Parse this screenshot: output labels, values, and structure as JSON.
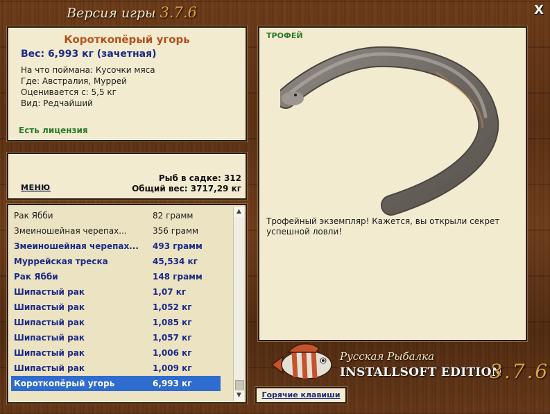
{
  "window": {
    "version_label": "Версия игры",
    "version": "3.7.6",
    "close_glyph": "X"
  },
  "fish_info": {
    "name": "Короткопёрый угорь",
    "weight": "Вес: 6,993 кг (зачетная)",
    "caught_on": "На что поймана: Кусочки мяса",
    "location": "Где: Австралия, Муррей",
    "rated_from": "Оценивается с: 5,5 кг",
    "rarity": "Вид: Редчайший",
    "license": "Есть лицензия"
  },
  "stats": {
    "menu_label": "МЕНЮ",
    "fish_in_keepnet": "Рыб в садке: 312",
    "total_weight": "Общий вес: 3717,29 кг"
  },
  "catch_list": {
    "rows": [
      {
        "name": "Рак Ябби",
        "weight": "82 грамм",
        "style": "normal"
      },
      {
        "name": "Змеиношейная черепах...",
        "weight": "356 грамм",
        "style": "normal"
      },
      {
        "name": "Змеиношейная черепах...",
        "weight": "493 грамм",
        "style": "bold"
      },
      {
        "name": "Муррейская треска",
        "weight": "45,534 кг",
        "style": "bold"
      },
      {
        "name": "Рак Ябби",
        "weight": "148 грамм",
        "style": "bold"
      },
      {
        "name": "Шипастый рак",
        "weight": "1,07 кг",
        "style": "bold"
      },
      {
        "name": "Шипастый рак",
        "weight": "1,052 кг",
        "style": "bold"
      },
      {
        "name": "Шипастый рак",
        "weight": "1,085 кг",
        "style": "bold"
      },
      {
        "name": "Шипастый рак",
        "weight": "1,057 кг",
        "style": "bold"
      },
      {
        "name": "Шипастый рак",
        "weight": "1,006 кг",
        "style": "bold"
      },
      {
        "name": "Шипастый рак",
        "weight": "1,009 кг",
        "style": "bold"
      },
      {
        "name": "Короткопёрый угорь",
        "weight": "6,993 кг",
        "style": "selected"
      }
    ]
  },
  "trophy": {
    "label": "ТРОФЕЙ",
    "caption": "Трофейный экземпляр! Кажется, вы открыли секрет успешной ловли!"
  },
  "branding": {
    "game_name": "Русская Рыбалка",
    "edition": "INSTALLSOFT EDITION",
    "version": "3.7.6"
  },
  "hotkeys_label": "Горячие клавиши",
  "colors": {
    "fish_name": "#b5501b",
    "weight": "#1b2a88",
    "license": "#2d7a2a",
    "selected_row": "#2f6ccf",
    "version_accent": "#e0a23a"
  }
}
